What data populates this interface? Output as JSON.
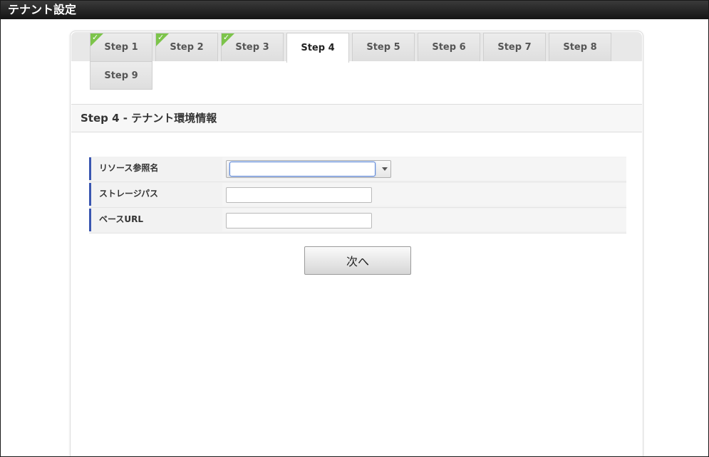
{
  "window": {
    "title": "テナント設定"
  },
  "tabs": [
    {
      "label": "Step 1",
      "completed": true,
      "active": false
    },
    {
      "label": "Step 2",
      "completed": true,
      "active": false
    },
    {
      "label": "Step 3",
      "completed": true,
      "active": false
    },
    {
      "label": "Step 4",
      "completed": false,
      "active": true
    },
    {
      "label": "Step 5",
      "completed": false,
      "active": false
    },
    {
      "label": "Step 6",
      "completed": false,
      "active": false
    },
    {
      "label": "Step 7",
      "completed": false,
      "active": false
    },
    {
      "label": "Step 8",
      "completed": false,
      "active": false
    },
    {
      "label": "Step 9",
      "completed": false,
      "active": false
    }
  ],
  "section": {
    "title": "Step 4 - テナント環境情報"
  },
  "form": {
    "resource_ref": {
      "label": "リソース参照名",
      "value": ""
    },
    "storage_path": {
      "label": "ストレージパス",
      "value": ""
    },
    "base_url": {
      "label": "ベースURL",
      "value": ""
    }
  },
  "actions": {
    "next_label": "次へ"
  },
  "colors": {
    "titlebar": "#1f1f1f",
    "check": "#7cc44a",
    "label_accent": "#3a56b0",
    "focus_border": "#5b86d8"
  },
  "icons": {
    "completed": "checkmark-icon",
    "dropdown": "chevron-down-icon"
  }
}
